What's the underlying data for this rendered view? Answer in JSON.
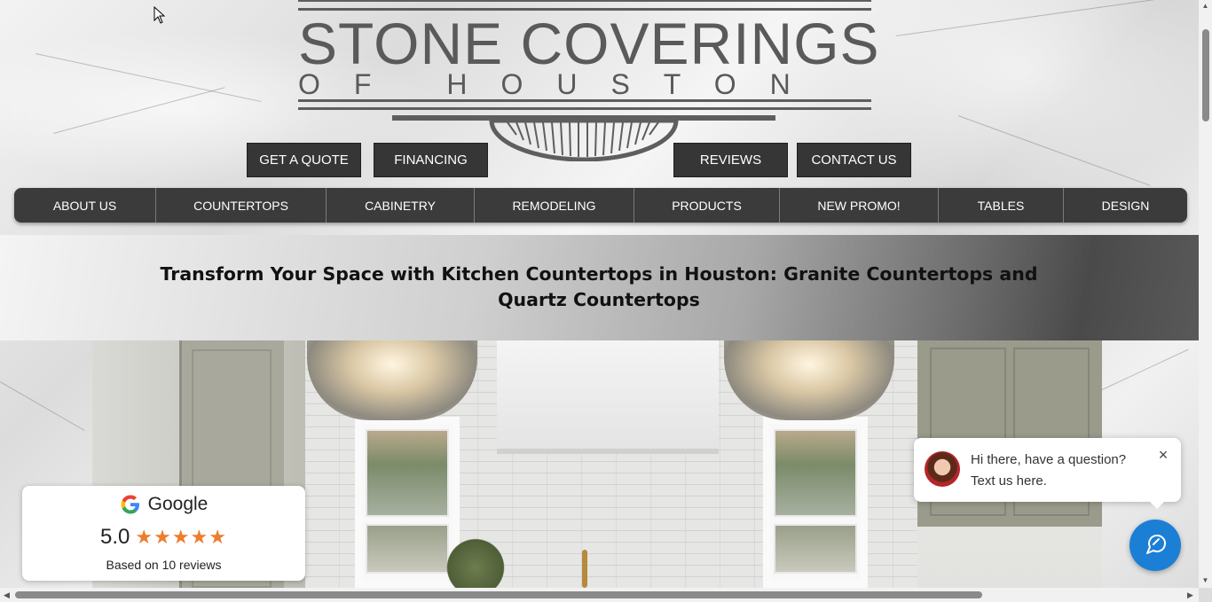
{
  "logo": {
    "title": "STONE COVERINGS",
    "subtitle": "OF HOUSTON"
  },
  "buttons": {
    "quote": "GET A QUOTE",
    "financing": "FINANCING",
    "reviews": "REVIEWS",
    "contact": "CONTACT US"
  },
  "nav": {
    "items": [
      "ABOUT US",
      "COUNTERTOPS",
      "CABINETRY",
      "REMODELING",
      "PRODUCTS",
      "NEW PROMO!",
      "TABLES",
      "DESIGN"
    ]
  },
  "hero": {
    "headline": "Transform Your Space with Kitchen Countertops in Houston: Granite Countertops and Quartz Countertops"
  },
  "google_card": {
    "brand": "Google",
    "score": "5.0",
    "stars": "★★★★★",
    "star_count": 5,
    "based_on": "Based on 10 reviews"
  },
  "chat": {
    "message": "Hi there, have a question? Text us here.",
    "close": "×"
  },
  "colors": {
    "button_bg": "#363636",
    "nav_bg": "#3b3b3b",
    "star": "#ee7d2e",
    "chat_fab": "#1b7fd6"
  }
}
